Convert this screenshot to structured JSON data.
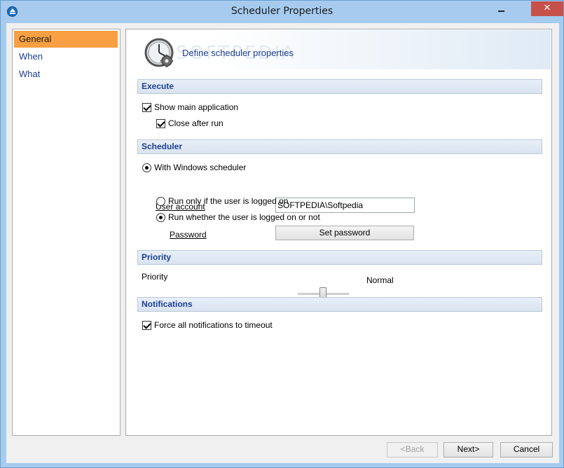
{
  "window": {
    "title": "Scheduler Properties",
    "close_glyph": "✕"
  },
  "nav": {
    "items": [
      {
        "label": "General",
        "active": true
      },
      {
        "label": "When",
        "active": false
      },
      {
        "label": "What",
        "active": false
      }
    ]
  },
  "header": {
    "title": "Define scheduler properties",
    "watermark": "SOFTPEDIA",
    "icon": "clock-gear-icon"
  },
  "execute": {
    "title": "Execute",
    "show_main_app": {
      "label": "Show main application",
      "checked": true
    },
    "close_after_run": {
      "label": "Close after run",
      "checked": true
    }
  },
  "scheduler": {
    "title": "Scheduler",
    "with_windows": {
      "label": "With Windows scheduler",
      "selected": true
    },
    "user_account_label": "User account",
    "user_account_value": "SOFTPEDIA\\Softpedia",
    "run_logged_on": {
      "label": "Run only if the user is logged on",
      "selected": false
    },
    "run_whether": {
      "label": "Run whether the user is logged on or not",
      "selected": true
    },
    "password_label": "Password",
    "set_password": "Set password"
  },
  "priority": {
    "title": "Priority",
    "label": "Priority",
    "value": "Normal",
    "level": 0.5
  },
  "notifications": {
    "title": "Notifications",
    "force_timeout": {
      "label": "Force all notifications to timeout",
      "checked": true
    }
  },
  "footer": {
    "back": "<Back",
    "next": "Next>",
    "cancel": "Cancel"
  },
  "colors": {
    "accent": "#f8a043",
    "section_text": "#1c3f94",
    "close": "#c7504b"
  }
}
